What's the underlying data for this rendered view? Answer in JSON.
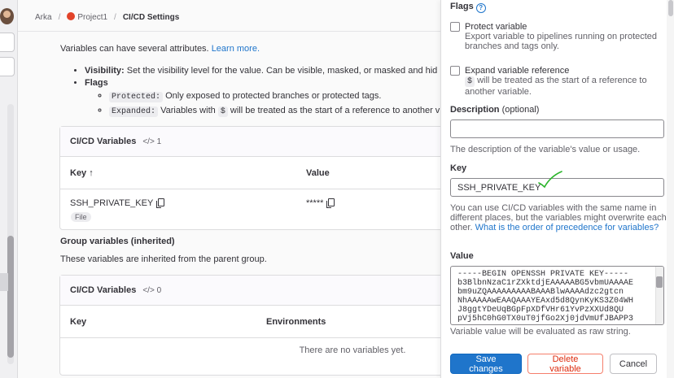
{
  "breadcrumb": {
    "items": [
      "Arka",
      "Project1",
      "CI/CD Settings"
    ],
    "separator": "/"
  },
  "intro": {
    "text": "Variables can have several attributes.",
    "link": "Learn more."
  },
  "attributes": {
    "visibility_label": "Visibility:",
    "visibility_text": "Set the visibility level for the value. Can be visible, masked, or masked and hid",
    "flags_label": "Flags",
    "protected_code": "Protected:",
    "protected_text": "Only exposed to protected branches or protected tags.",
    "expanded_code": "Expanded:",
    "expanded_text_a": "Variables with",
    "expanded_dollar": "$",
    "expanded_text_b": "will be treated as the start of a reference to another v"
  },
  "cicd_card": {
    "title": "CI/CD Variables",
    "count_icon": "code-icon",
    "count": "1",
    "col_key": "Key",
    "sort_icon": "↑",
    "col_value": "Value",
    "row_key": "SSH_PRIVATE_KEY",
    "row_badge": "File",
    "row_value": "*****"
  },
  "group": {
    "title": "Group variables (inherited)",
    "desc": "These variables are inherited from the parent group."
  },
  "group_card": {
    "title": "CI/CD Variables",
    "count": "0",
    "col_key": "Key",
    "col_env": "Environments",
    "empty": "There are no variables yet."
  },
  "drawer": {
    "flags_label": "Flags",
    "protect_title": "Protect variable",
    "protect_desc": "Export variable to pipelines running on protected branches and tags only.",
    "expand_title": "Expand variable reference",
    "expand_code": "$",
    "expand_desc": "will be treated as the start of a reference to another variable.",
    "description_label": "Description",
    "description_optional": "(optional)",
    "description_value": "",
    "description_help": "The description of the variable's value or usage.",
    "key_label": "Key",
    "key_value": "SSH_PRIVATE_KEY",
    "key_help": "You can use CI/CD variables with the same name in different places, but the variables might overwrite each other.",
    "key_help_link": "What is the order of precedence for variables?",
    "value_label": "Value",
    "value_text": "-----BEGIN OPENSSH PRIVATE KEY-----\nb3BlbnNzaC1rZXktdjEAAAAABG5vbmUAAAAE\nbm9uZQAAAAAAAAABAAABlwAAAAdzc2gtcn\nNhAAAAAwEAAQAAAYEAxd5d8QynKyKS3Z04WH\nJ8ggtYDeUqBGpFpXDfVHr61YvPzXXUd8QU\npVj5hC0hG0TX0uT0jfGo2Xj0jdVmUfJBAPP3",
    "value_help": "Variable value will be evaluated as raw string.",
    "save_label": "Save changes",
    "delete_label": "Delete variable",
    "cancel_label": "Cancel"
  },
  "colors": {
    "accent": "#1f75cb",
    "danger": "#dd2b0e",
    "annotation": "#2bb52b"
  }
}
